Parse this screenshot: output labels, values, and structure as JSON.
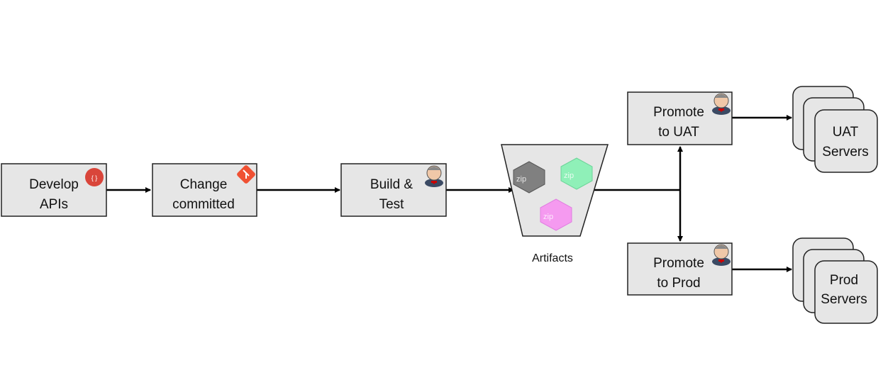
{
  "nodes": {
    "develop": {
      "line1": "Develop",
      "line2": "APIs",
      "icon": "api-icon"
    },
    "commit": {
      "line1": "Change",
      "line2": "committed",
      "icon": "git-icon"
    },
    "build": {
      "line1": "Build &",
      "line2": "Test",
      "icon": "jenkins-icon"
    },
    "artifacts": {
      "label": "Artifacts",
      "zip_label": "zip",
      "colors": [
        "#808080",
        "#8ff0b8",
        "#f59af0"
      ]
    },
    "uat": {
      "line1": "Promote",
      "line2": "to UAT",
      "icon": "jenkins-icon"
    },
    "prod": {
      "line1": "Promote",
      "line2": "to Prod",
      "icon": "jenkins-icon"
    },
    "uat_servers": {
      "line1": "UAT",
      "line2": "Servers"
    },
    "prod_servers": {
      "line1": "Prod",
      "line2": "Servers"
    }
  },
  "colors": {
    "box_fill": "#e6e6e6",
    "api_icon": "#d9453a",
    "git_icon": "#f05133"
  }
}
